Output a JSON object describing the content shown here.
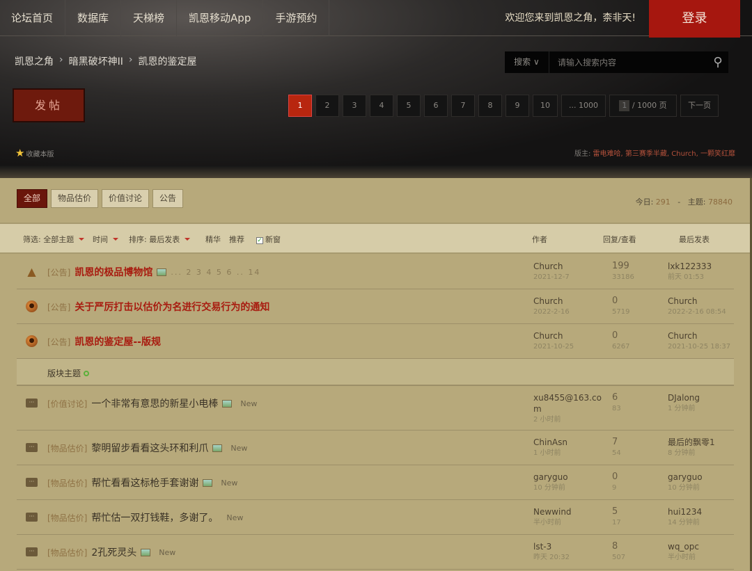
{
  "nav": {
    "items": [
      "论坛首页",
      "数据库",
      "天梯榜",
      "凯恩移动App",
      "手游预约"
    ],
    "welcome": "欢迎您来到凯恩之角，柰非天!",
    "login": "登录"
  },
  "breadcrumb": [
    "凯恩之角",
    "暗黑破坏神II",
    "凯恩的鉴定屋"
  ],
  "search": {
    "type": "搜索",
    "placeholder": "请输入搜索内容"
  },
  "post_button": "发帖",
  "pagination": {
    "pages": [
      "1",
      "2",
      "3",
      "4",
      "5",
      "6",
      "7",
      "8",
      "9",
      "10",
      "... 1000"
    ],
    "current": "1",
    "jump_value": "1",
    "jump_total": "/ 1000 页",
    "next": "下一页"
  },
  "favorite": "收藏本版",
  "moderators": {
    "label": "版主:",
    "names": "雷电难哈, 第三赛季半藏, Church, 一颗笑红靡"
  },
  "tabs": [
    "全部",
    "物品估价",
    "价值讨论",
    "公告"
  ],
  "stats": {
    "today_label": "今日:",
    "today": "291",
    "sep": "-",
    "topics_label": "主题:",
    "topics": "78840"
  },
  "filter": {
    "filter": "筛选: 全部主题",
    "time": "时间",
    "sort": "排序: 最后发表",
    "digest": "精华",
    "recommend": "推荐",
    "newwin": "新窗",
    "author": "作者",
    "replies": "回复/查看",
    "last": "最后发表"
  },
  "pinned": [
    {
      "icon": "tree",
      "tag": "[公告]",
      "title": "凯恩的极品博物馆",
      "img": true,
      "pages": "... 2 3 4 5 6 .. 14",
      "author": "Church",
      "date": "2021-12-7",
      "replies": "199",
      "views": "33186",
      "last_user": "lxk122333",
      "last_time": "前天 01:53"
    },
    {
      "icon": "lock",
      "tag": "[公告]",
      "title": "关于严厉打击以估价为名进行交易行为的通知",
      "author": "Church",
      "date": "2022-2-16",
      "replies": "0",
      "views": "5719",
      "last_user": "Church",
      "last_time": "2022-2-16 08:54"
    },
    {
      "icon": "lock",
      "tag": "[公告]",
      "title": "凯恩的鉴定屋--版规",
      "author": "Church",
      "date": "2021-10-25",
      "replies": "0",
      "views": "6267",
      "last_user": "Church",
      "last_time": "2021-10-25 18:37"
    }
  ],
  "section_label": "版块主题",
  "threads": [
    {
      "tag": "[价值讨论]",
      "title": "一个非常有意思的新星小电棒",
      "img": true,
      "new": "New",
      "author": "xu8455@163.com",
      "date": "2 小时前",
      "replies": "6",
      "views": "83",
      "last_user": "DJalong",
      "last_time": "1 分钟前"
    },
    {
      "tag": "[物品估价]",
      "title": "黎明留步看看这头环和利爪",
      "img": true,
      "new": "New",
      "author": "ChinAsn",
      "date": "1 小时前",
      "replies": "7",
      "views": "54",
      "last_user": "最后的飘零1",
      "last_time": "8 分钟前"
    },
    {
      "tag": "[物品估价]",
      "title": "帮忙看看这标枪手套谢谢",
      "img": true,
      "new": "New",
      "author": "garyguo",
      "date": "10 分钟前",
      "replies": "0",
      "views": "9",
      "last_user": "garyguo",
      "last_time": "10 分钟前"
    },
    {
      "tag": "[物品估价]",
      "title": "帮忙估一双打钱鞋，多谢了。",
      "img": false,
      "new": "New",
      "author": "Newwind",
      "date": "半小时前",
      "replies": "5",
      "views": "17",
      "last_user": "hui1234",
      "last_time": "14 分钟前"
    },
    {
      "tag": "[物品估价]",
      "title": "2孔死灵头",
      "img": true,
      "new": "New",
      "author": "lst-3",
      "date": "昨天 20:32",
      "replies": "8",
      "views": "507",
      "last_user": "wq_opc",
      "last_time": "半小时前"
    }
  ]
}
